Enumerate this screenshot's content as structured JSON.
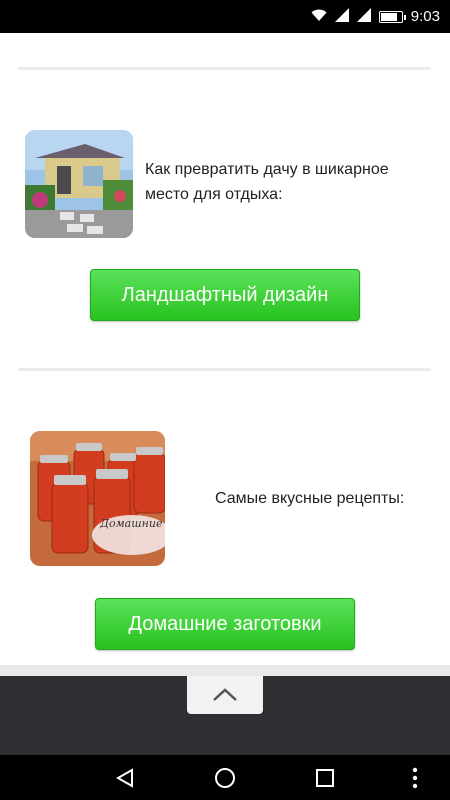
{
  "status_bar": {
    "time": "9:03",
    "icons": [
      "wifi-icon",
      "signal-icon",
      "signal-icon",
      "battery-icon"
    ],
    "battery_level": 0.85
  },
  "cards": [
    {
      "image_icon": "garden-house-photo",
      "text": "Как превратить дачу в шикарное место для отдыха:",
      "button_label": "Ландшафтный дизайн"
    },
    {
      "image_icon": "jars-photo",
      "image_caption": "Домашние заготовки",
      "text": "Самые вкусные рецепты:",
      "button_label": "Домашние заготовки"
    }
  ],
  "toolbar": {
    "scroll_up_icon": "chevron-up-icon"
  },
  "nav_bar": {
    "icons": [
      "back-icon",
      "home-icon",
      "recents-icon",
      "more-icon"
    ]
  },
  "colors": {
    "button_green": "#2ec424",
    "toolbar_bg": "#2d2f33"
  }
}
